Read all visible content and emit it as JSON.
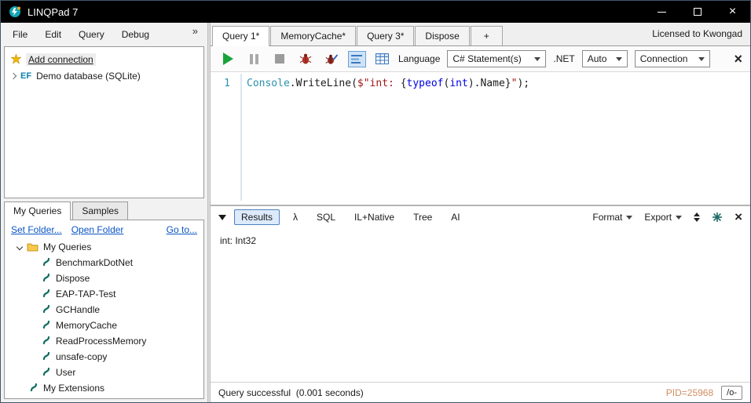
{
  "window": {
    "title": "LINQPad 7",
    "close_glyph": "×"
  },
  "menu": {
    "items": [
      "File",
      "Edit",
      "Query",
      "Debug"
    ],
    "overflow_glyph": "»"
  },
  "header": {
    "license": "Licensed to Kwongad"
  },
  "connections": {
    "add_label": "Add connection",
    "ef_badge": "EF",
    "demo_label": "Demo database (SQLite)"
  },
  "queries": {
    "tabs": [
      "My Queries",
      "Samples"
    ],
    "links": [
      "Set Folder...",
      "Open Folder",
      "Go to..."
    ],
    "tree_root": "My Queries",
    "tree_items": [
      "BenchmarkDotNet",
      "Dispose",
      "EAP-TAP-Test",
      "GCHandle",
      "MemoryCache",
      "ReadProcessMemory",
      "unsafe-copy",
      "User"
    ],
    "extensions_label": "My Extensions"
  },
  "query_tabs": {
    "tabs": [
      "Query 1*",
      "MemoryCache*",
      "Query 3*",
      "Dispose"
    ],
    "add_label": "+"
  },
  "toolbar": {
    "language_label": "Language",
    "language_value": "C# Statement(s)",
    "dotnet_label": ".NET",
    "dotnet_value": "Auto",
    "connection_value": "Connection",
    "close_glyph": "×"
  },
  "editor": {
    "line_number": "1",
    "tokens": [
      "Console",
      ".WriteLine",
      "(",
      "$\"int: ",
      "{",
      "typeof",
      "(",
      "int",
      ")",
      ".Name",
      "}",
      "\"",
      ");"
    ]
  },
  "results": {
    "tabs": [
      "Results",
      "λ",
      "SQL",
      "IL+Native",
      "Tree",
      "AI"
    ],
    "format_label": "Format",
    "export_label": "Export",
    "close_glyph": "×",
    "output": "int: Int32"
  },
  "statusbar": {
    "status": "Query successful  (0.001 seconds)",
    "pid": "PID=25968",
    "optimization_toggle": "/o-"
  },
  "colors": {
    "titlebar": "#000000",
    "play_green": "#19a33c",
    "type_teal": "#2b91af",
    "keyword_blue": "#0000e6",
    "string_red": "#a31515",
    "link_blue": "#0a55c4",
    "results_tab_border": "#4f81bd",
    "pid_orange": "#cf8e62"
  }
}
